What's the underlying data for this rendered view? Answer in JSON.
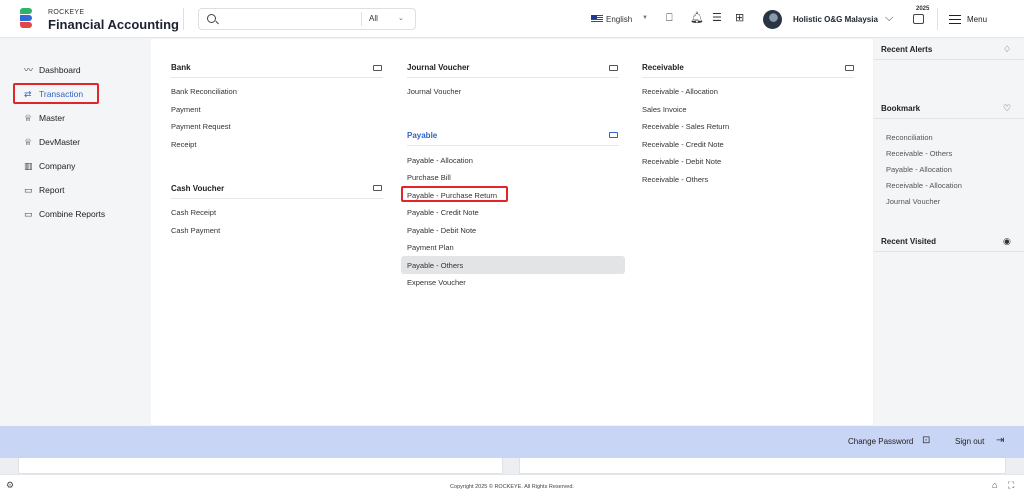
{
  "header": {
    "brand_top": "ROCKEYE",
    "brand_main": "Financial Accounting",
    "search_scope": "All",
    "language": "English",
    "company": "Holistic O&G Malaysia",
    "year": "2025",
    "menu_label": "Menu"
  },
  "sidebar": {
    "items": [
      {
        "label": "Dashboard"
      },
      {
        "label": "Transaction"
      },
      {
        "label": "Master"
      },
      {
        "label": "DevMaster"
      },
      {
        "label": "Company"
      },
      {
        "label": "Report"
      },
      {
        "label": "Combine Reports"
      }
    ]
  },
  "sections": {
    "bank": {
      "title": "Bank",
      "items": [
        "Bank Reconciliation",
        "Payment",
        "Payment Request",
        "Receipt"
      ]
    },
    "cash_voucher": {
      "title": "Cash Voucher",
      "items": [
        "Cash Receipt",
        "Cash Payment"
      ]
    },
    "journal_voucher": {
      "title": "Journal Voucher",
      "items": [
        "Journal Voucher"
      ]
    },
    "payable": {
      "title": "Payable",
      "items": [
        "Payable - Allocation",
        "Purchase Bill",
        "Payable - Purchase Return",
        "Payable - Credit Note",
        "Payable - Debit Note",
        "Payment Plan",
        "Payable - Others",
        "Expense Voucher"
      ]
    },
    "receivable": {
      "title": "Receivable",
      "items": [
        "Receivable - Allocation",
        "Sales Invoice",
        "Receivable - Sales Return",
        "Receivable - Credit Note",
        "Receivable - Debit Note",
        "Receivable - Others"
      ]
    }
  },
  "right_panel": {
    "recent_alerts": "Recent Alerts",
    "bookmark": "Bookmark",
    "bookmarks": [
      "Reconciliation",
      "Receivable - Others",
      "Payable - Allocation",
      "Receivable - Allocation",
      "Journal Voucher"
    ],
    "recent_visited": "Recent Visited"
  },
  "bottom": {
    "change_password": "Change Password",
    "sign_out": "Sign out"
  },
  "footer": {
    "copyright": "Copyright 2025 © ROCKEYE. All Rights Reserved."
  },
  "colors": {
    "accent": "#2f64c6",
    "highlight_border": "#e0262a",
    "bottom_bar": "#c9d5f5"
  }
}
